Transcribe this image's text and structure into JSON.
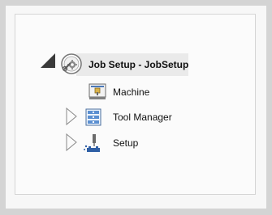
{
  "tree": {
    "root": {
      "label": "Job Setup - JobSetup",
      "icon": "job-setup-icon",
      "expanded": true
    },
    "children": [
      {
        "label": "Machine",
        "icon": "machine-icon",
        "has_children": false
      },
      {
        "label": "Tool Manager",
        "icon": "tool-manager-icon",
        "has_children": true,
        "expanded": false
      },
      {
        "label": "Setup",
        "icon": "setup-icon",
        "has_children": true,
        "expanded": false
      }
    ]
  },
  "colors": {
    "frame": "#d4d4d4",
    "highlight": "#eaeaea",
    "text": "#111111"
  }
}
